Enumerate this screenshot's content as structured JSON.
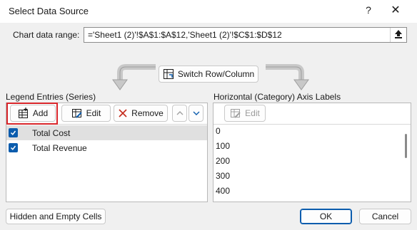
{
  "dialog": {
    "title": "Select Data Source",
    "help_glyph": "?",
    "close_glyph": "✕"
  },
  "chart_range": {
    "label": "Chart data range:",
    "value": "='Sheet1 (2)'!$A$1:$A$12,'Sheet1 (2)'!$C$1:$D$12"
  },
  "switch_button": {
    "label": "Switch Row/Column"
  },
  "legend": {
    "heading": "Legend Entries (Series)",
    "add_label": "Add",
    "edit_label": "Edit",
    "remove_label": "Remove",
    "series": [
      {
        "name": "Total Cost",
        "checked": true,
        "selected": true
      },
      {
        "name": "Total Revenue",
        "checked": true,
        "selected": false
      }
    ]
  },
  "axis": {
    "heading": "Horizontal (Category) Axis Labels",
    "edit_label": "Edit",
    "items": [
      "0",
      "100",
      "200",
      "300",
      "400"
    ]
  },
  "footer": {
    "hidden_cells_label": "Hidden and Empty Cells",
    "ok_label": "OK",
    "cancel_label": "Cancel"
  },
  "colors": {
    "accent": "#0b5cad",
    "highlight_box": "#d9262b",
    "remove_icon": "#c42b1c"
  }
}
